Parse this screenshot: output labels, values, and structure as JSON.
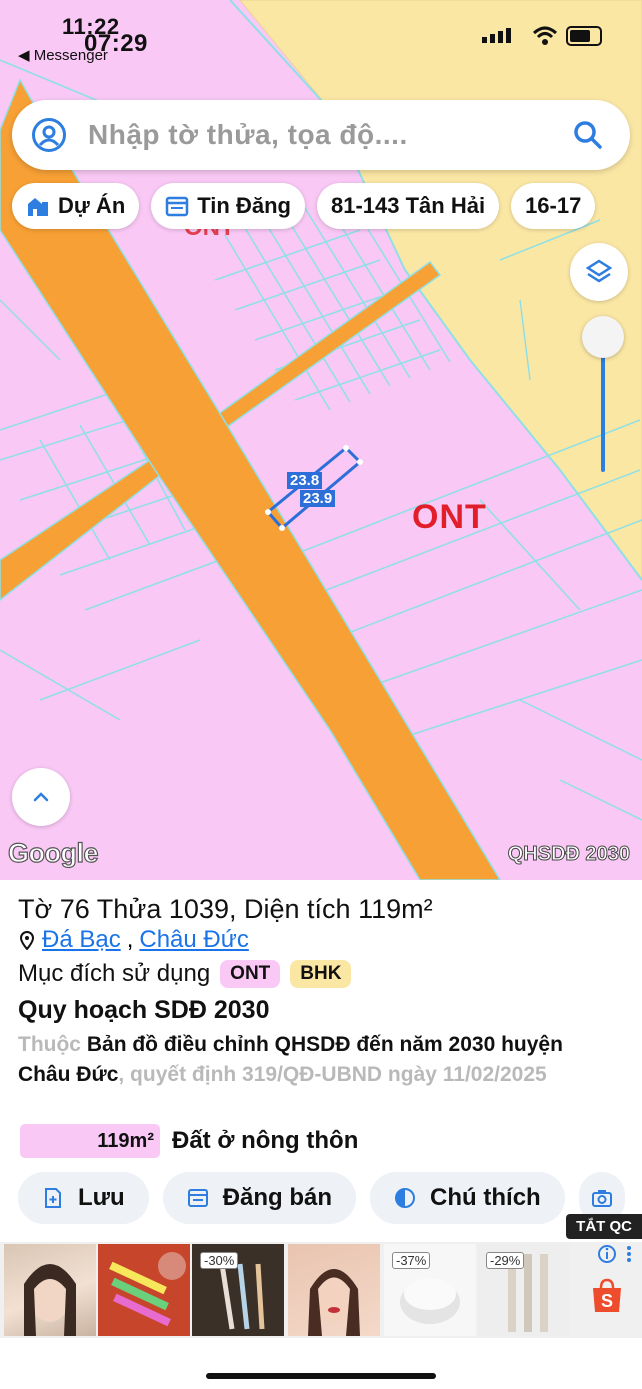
{
  "status_bar": {
    "time_back": "11:22",
    "time_front": "07:29",
    "back_app": "◀ Messenger"
  },
  "search": {
    "placeholder": "Nhập tờ thửa, tọa độ....",
    "user_icon": "user-circle-icon",
    "search_icon": "magnifier-icon"
  },
  "chips": [
    {
      "label": "Dự Án",
      "icon": "building-icon"
    },
    {
      "label": "Tin Đăng",
      "icon": "listing-icon"
    },
    {
      "label": "81-143 Tân Hải",
      "icon": ""
    },
    {
      "label": "16-17",
      "icon": ""
    }
  ],
  "map": {
    "zone_label": "ONT",
    "zone_label_top": "ONT",
    "parcel_dims": [
      "23.8",
      "23.9"
    ],
    "attribution": "Google",
    "layer_badge": "QHSDĐ 2030",
    "colors": {
      "residential": "#f9c8f5",
      "road": "#f7a035",
      "agri": "#fbe7a4",
      "boundary": "#8ee0e6",
      "parcel": "#2d6fd8"
    }
  },
  "panel": {
    "title_prefix": "Tờ",
    "sheet": "76",
    "plot_label": "Thửa",
    "plot": "1039",
    "area_label": "Diện tích",
    "area": "119m²",
    "location": [
      "Đá Bạc",
      "Châu Đức"
    ],
    "purpose_label": "Mục đích sử dụng",
    "purpose_tags": [
      {
        "code": "ONT",
        "color": "#f9c8f5"
      },
      {
        "code": "BHK",
        "color": "#fbe7a4"
      }
    ],
    "plan_title": "Quy hoạch SDĐ 2030",
    "desc_prefix": "Thuộc",
    "desc_main": "Bản đồ điều chỉnh QHSDĐ đến năm 2030 huyện Châu Đức",
    "desc_suffix": ", quyết định 319/QĐ-UBND ngày 11/02/2025",
    "legend_area": "119m²",
    "legend_text": "Đất ở nông thôn",
    "actions": [
      {
        "label": "Lưu",
        "icon": "save-plus-icon"
      },
      {
        "label": "Đăng bán",
        "icon": "post-sale-icon"
      },
      {
        "label": "Chú thích",
        "icon": "contrast-icon"
      },
      {
        "label": "",
        "icon": "camera-icon"
      }
    ]
  },
  "ads": {
    "close_label": "TẮT QC",
    "discounts": [
      "-30%",
      "-37%",
      "-29%"
    ]
  }
}
